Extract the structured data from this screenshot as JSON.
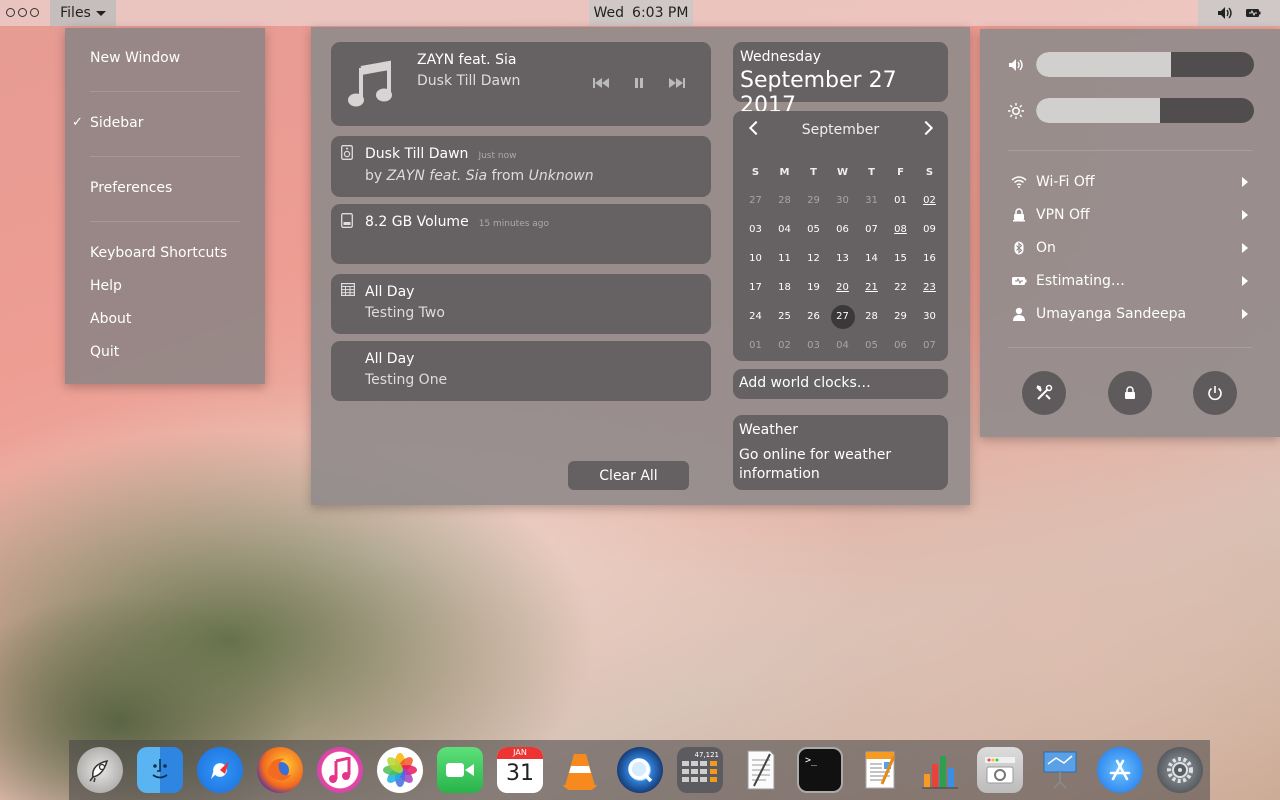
{
  "topbar": {
    "app_menu": "Files",
    "clock": {
      "day": "Wed",
      "time": "6:03 PM"
    },
    "tray_icons": [
      "volume-icon",
      "battery-icon"
    ]
  },
  "files_menu": {
    "items": [
      {
        "label": "New Window",
        "checked": false
      },
      {
        "label": "Sidebar",
        "checked": true
      },
      {
        "label": "Preferences",
        "checked": false
      },
      {
        "label": "Keyboard Shortcuts",
        "checked": false
      },
      {
        "label": "Help",
        "checked": false
      },
      {
        "label": "About",
        "checked": false
      },
      {
        "label": "Quit",
        "checked": false
      }
    ],
    "check_mark": "✓"
  },
  "media": {
    "artist": "ZAYN feat. Sia",
    "song": "Dusk Till Dawn",
    "icon": "music-note-icon"
  },
  "notifications": [
    {
      "title": "Dusk Till Dawn",
      "time": "Just now",
      "by_prefix": "by",
      "artist": "ZAYN feat. Sia",
      "from_prefix": "from",
      "album": "Unknown",
      "icon": "speaker-icon"
    },
    {
      "title": "8.2 GB Volume",
      "time": "15 minutes ago",
      "icon": "drive-icon"
    },
    {
      "title": "All Day",
      "subtitle": "Testing Two",
      "icon": "calendar-grid-icon"
    },
    {
      "title": "All Day",
      "subtitle": "Testing One"
    }
  ],
  "clear_all_label": "Clear All",
  "date": {
    "weekday": "Wednesday",
    "full": "September 27 2017"
  },
  "calendar": {
    "month": "September",
    "weekdays": [
      "S",
      "M",
      "T",
      "W",
      "T",
      "F",
      "S"
    ],
    "days": [
      {
        "d": "27",
        "dim": true
      },
      {
        "d": "28",
        "dim": true
      },
      {
        "d": "29",
        "dim": true
      },
      {
        "d": "30",
        "dim": true
      },
      {
        "d": "31",
        "dim": true
      },
      {
        "d": "01"
      },
      {
        "d": "02",
        "ev": true
      },
      {
        "d": "03"
      },
      {
        "d": "04"
      },
      {
        "d": "05"
      },
      {
        "d": "06"
      },
      {
        "d": "07"
      },
      {
        "d": "08",
        "ev": true
      },
      {
        "d": "09"
      },
      {
        "d": "10"
      },
      {
        "d": "11"
      },
      {
        "d": "12"
      },
      {
        "d": "13"
      },
      {
        "d": "14"
      },
      {
        "d": "15"
      },
      {
        "d": "16"
      },
      {
        "d": "17"
      },
      {
        "d": "18"
      },
      {
        "d": "19"
      },
      {
        "d": "20",
        "ev": true
      },
      {
        "d": "21",
        "ev": true
      },
      {
        "d": "22"
      },
      {
        "d": "23",
        "ev": true
      },
      {
        "d": "24"
      },
      {
        "d": "25"
      },
      {
        "d": "26"
      },
      {
        "d": "27",
        "today": true
      },
      {
        "d": "28"
      },
      {
        "d": "29"
      },
      {
        "d": "30"
      },
      {
        "d": "01",
        "dim": true
      },
      {
        "d": "02",
        "dim": true
      },
      {
        "d": "03",
        "dim": true
      },
      {
        "d": "04",
        "dim": true
      },
      {
        "d": "05",
        "dim": true
      },
      {
        "d": "06",
        "dim": true
      },
      {
        "d": "07",
        "dim": true
      }
    ]
  },
  "world_clocks_label": "Add world clocks…",
  "weather": {
    "title": "Weather",
    "message": "Go online for weather information"
  },
  "system": {
    "volume_level": 0.62,
    "brightness_level": 0.57,
    "rows": [
      {
        "label": "Wi-Fi Off",
        "icon": "wifi-icon"
      },
      {
        "label": "VPN Off",
        "icon": "vpn-lock-icon"
      },
      {
        "label": "On",
        "icon": "bluetooth-icon"
      },
      {
        "label": "Estimating…",
        "icon": "battery-icon"
      },
      {
        "label": "Umayanga Sandeepa",
        "icon": "user-icon"
      }
    ],
    "buttons": [
      "settings-icon",
      "lock-icon",
      "power-icon"
    ]
  },
  "dock": [
    "launchpad",
    "finder",
    "safari",
    "firefox",
    "itunes",
    "photos",
    "facetime",
    "calendar",
    "vlc",
    "quicktime",
    "calculator",
    "textedit",
    "terminal",
    "pages",
    "numbers",
    "photo-booth",
    "keynote",
    "app-store",
    "system-preferences"
  ],
  "dock_calendar": {
    "month": "JAN",
    "day": "31"
  },
  "dock_calculator_display": "47,121",
  "dock_terminal_prompt": ">_"
}
